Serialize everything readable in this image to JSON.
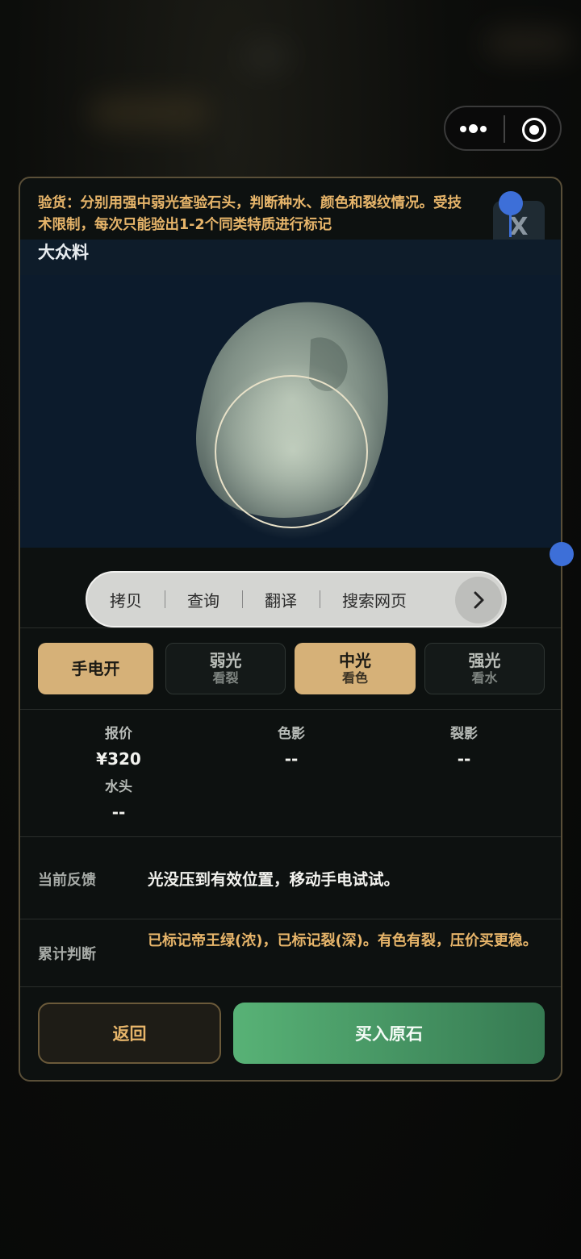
{
  "tip": "验货：分别用强中弱光查验石头，判断种水、颜色和裂纹情况。受技术限制，每次只能验出1-2个同类特质进行标记",
  "close_label": "X",
  "stone_name": "大众料",
  "context_menu": {
    "items": [
      "拷贝",
      "查询",
      "翻译",
      "搜索网页"
    ]
  },
  "modes": [
    {
      "label": "手电开",
      "sub": "",
      "active": true
    },
    {
      "label": "弱光",
      "sub": "看裂",
      "active": false
    },
    {
      "label": "中光",
      "sub": "看色",
      "active": true
    },
    {
      "label": "强光",
      "sub": "看水",
      "active": false
    }
  ],
  "stats": {
    "price": {
      "label": "报价",
      "value": "¥320"
    },
    "color_shadow": {
      "label": "色影",
      "value": "--"
    },
    "crack_shadow": {
      "label": "裂影",
      "value": "--"
    },
    "water": {
      "label": "水头",
      "value": "--"
    }
  },
  "feedback": {
    "label": "当前反馈",
    "text": "光没压到有效位置，移动手电试试。"
  },
  "judgement": {
    "label": "累计判断",
    "text": "已标记帝王绿(浓)，已标记裂(深)。有色有裂，压价买更稳。"
  },
  "buttons": {
    "back": "返回",
    "buy": "买入原石"
  },
  "colors": {
    "gold": "#d6b178",
    "tip_text": "#e7b56a",
    "selection_blue": "#3d6fd8",
    "buy_green": "#58b276"
  }
}
